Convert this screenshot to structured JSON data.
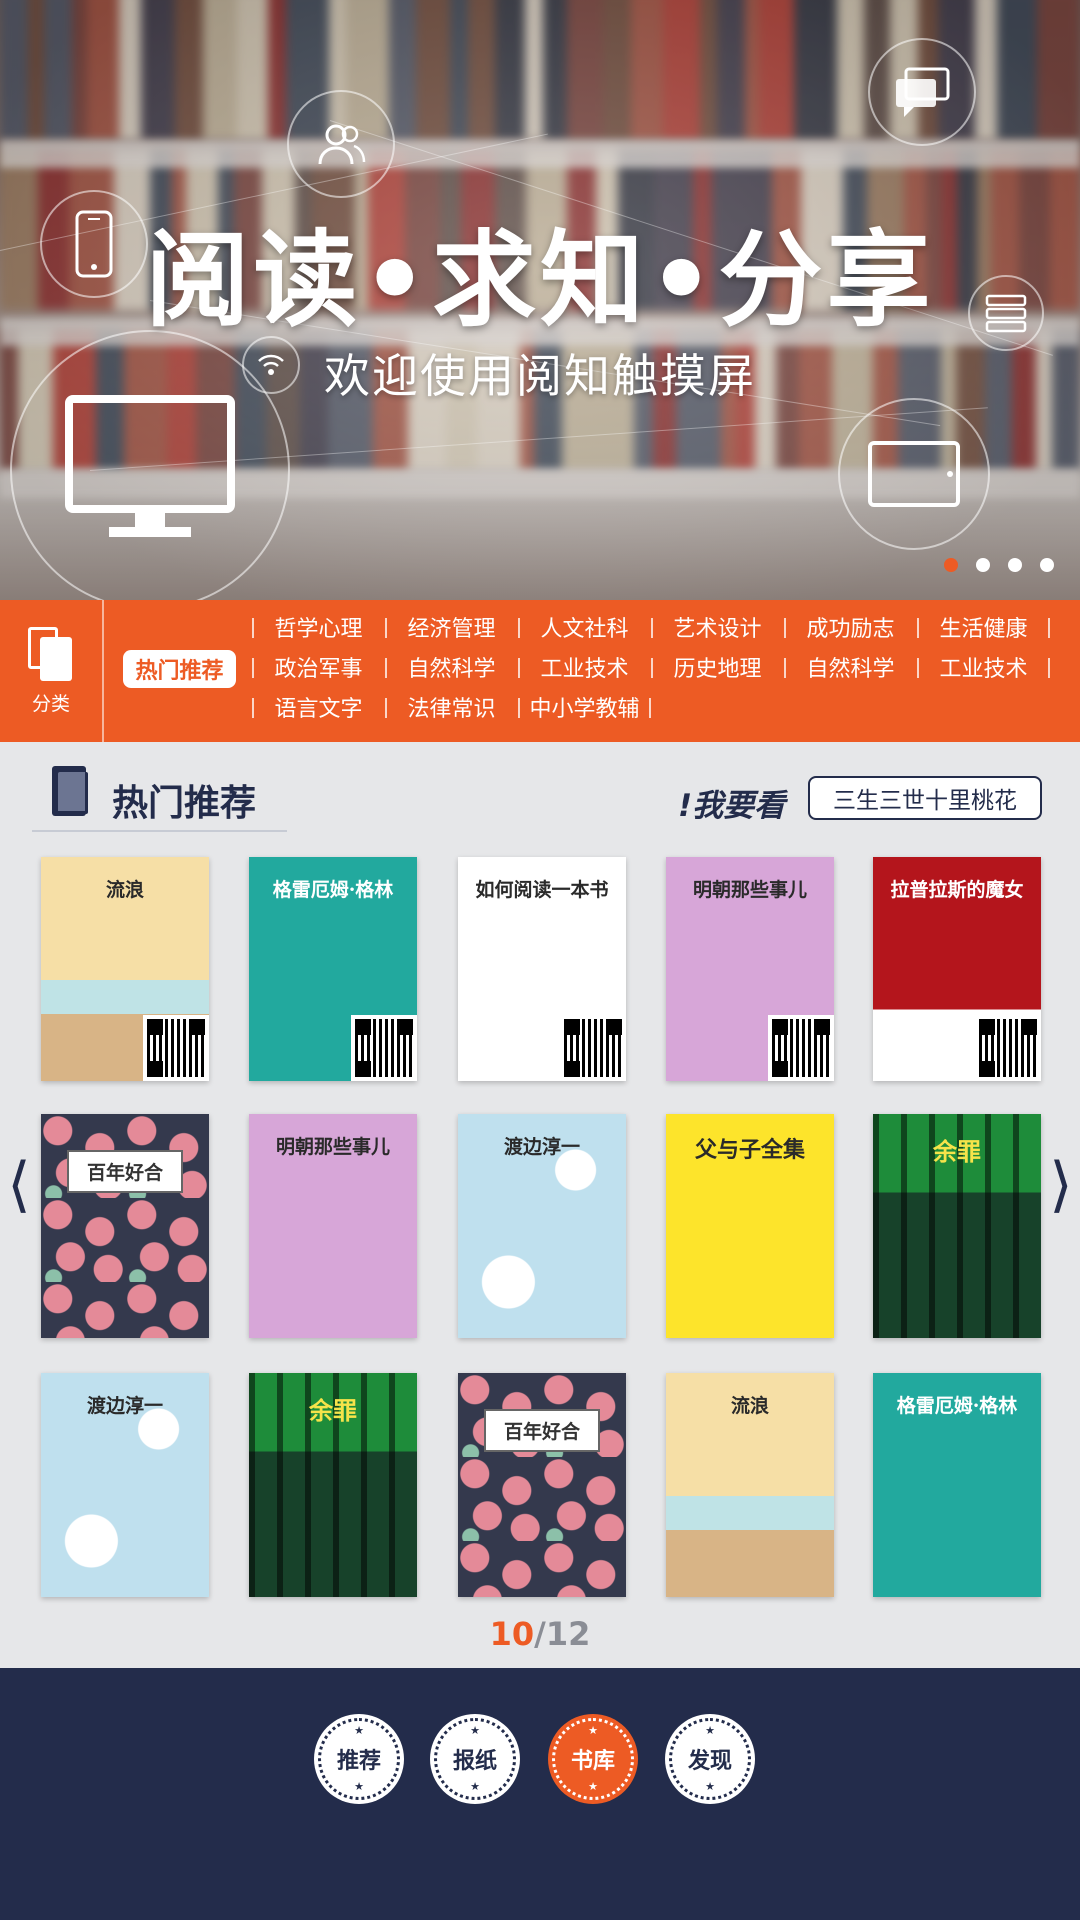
{
  "hero": {
    "title": "阅读•求知•分享",
    "subtitle": "欢迎使用阅知触摸屏",
    "slides": 4,
    "active_slide": 1
  },
  "category_bar": {
    "icon_label": "分类",
    "hot_label": "热门推荐",
    "items": [
      "哲学心理",
      "经济管理",
      "人文社科",
      "艺术设计",
      "成功励志",
      "生活健康",
      "政治军事",
      "自然科学",
      "工业技术",
      "历史地理",
      "自然科学",
      "工业技术",
      "语言文字",
      "法律常识",
      "中小学教辅"
    ]
  },
  "section": {
    "title": "热门推荐",
    "want_label": "!我要看",
    "want_value": "三生三世十里桃花"
  },
  "books": [
    {
      "title": "流浪",
      "bg": "#f6dfa6"
    },
    {
      "title": "格雷厄姆·格林",
      "bg": "#22a99e"
    },
    {
      "title": "如何阅读一本书",
      "bg": "#ffffff"
    },
    {
      "title": "明朝那些事儿",
      "bg": "#d7a6d8"
    },
    {
      "title": "拉普拉斯的魔女",
      "bg": "#b4151c"
    },
    {
      "title": "百年好合",
      "bg": "#34394d"
    },
    {
      "title": "明朝那些事儿",
      "bg": "#d7a6d8"
    },
    {
      "title": "渡边淳一",
      "bg": "#bfe0ee"
    },
    {
      "title": "父与子全集",
      "bg": "#fde42b"
    },
    {
      "title": "余罪",
      "bg": "#1e8c3a"
    },
    {
      "title": "渡边淳一",
      "bg": "#bfe0ee"
    },
    {
      "title": "余罪",
      "bg": "#1e8c3a"
    },
    {
      "title": "百年好合",
      "bg": "#34394d"
    },
    {
      "title": "流浪",
      "bg": "#f6dfa6"
    },
    {
      "title": "格雷厄姆·格林",
      "bg": "#22a99e"
    }
  ],
  "pager": {
    "current": "10",
    "separator": "/",
    "total": "12"
  },
  "nav": {
    "items": [
      "推荐",
      "报纸",
      "书库",
      "发现"
    ],
    "active_index": 2
  },
  "colors": {
    "accent": "#ed5b24",
    "navy": "#232c4b",
    "page_bg": "#e6e7e9"
  }
}
